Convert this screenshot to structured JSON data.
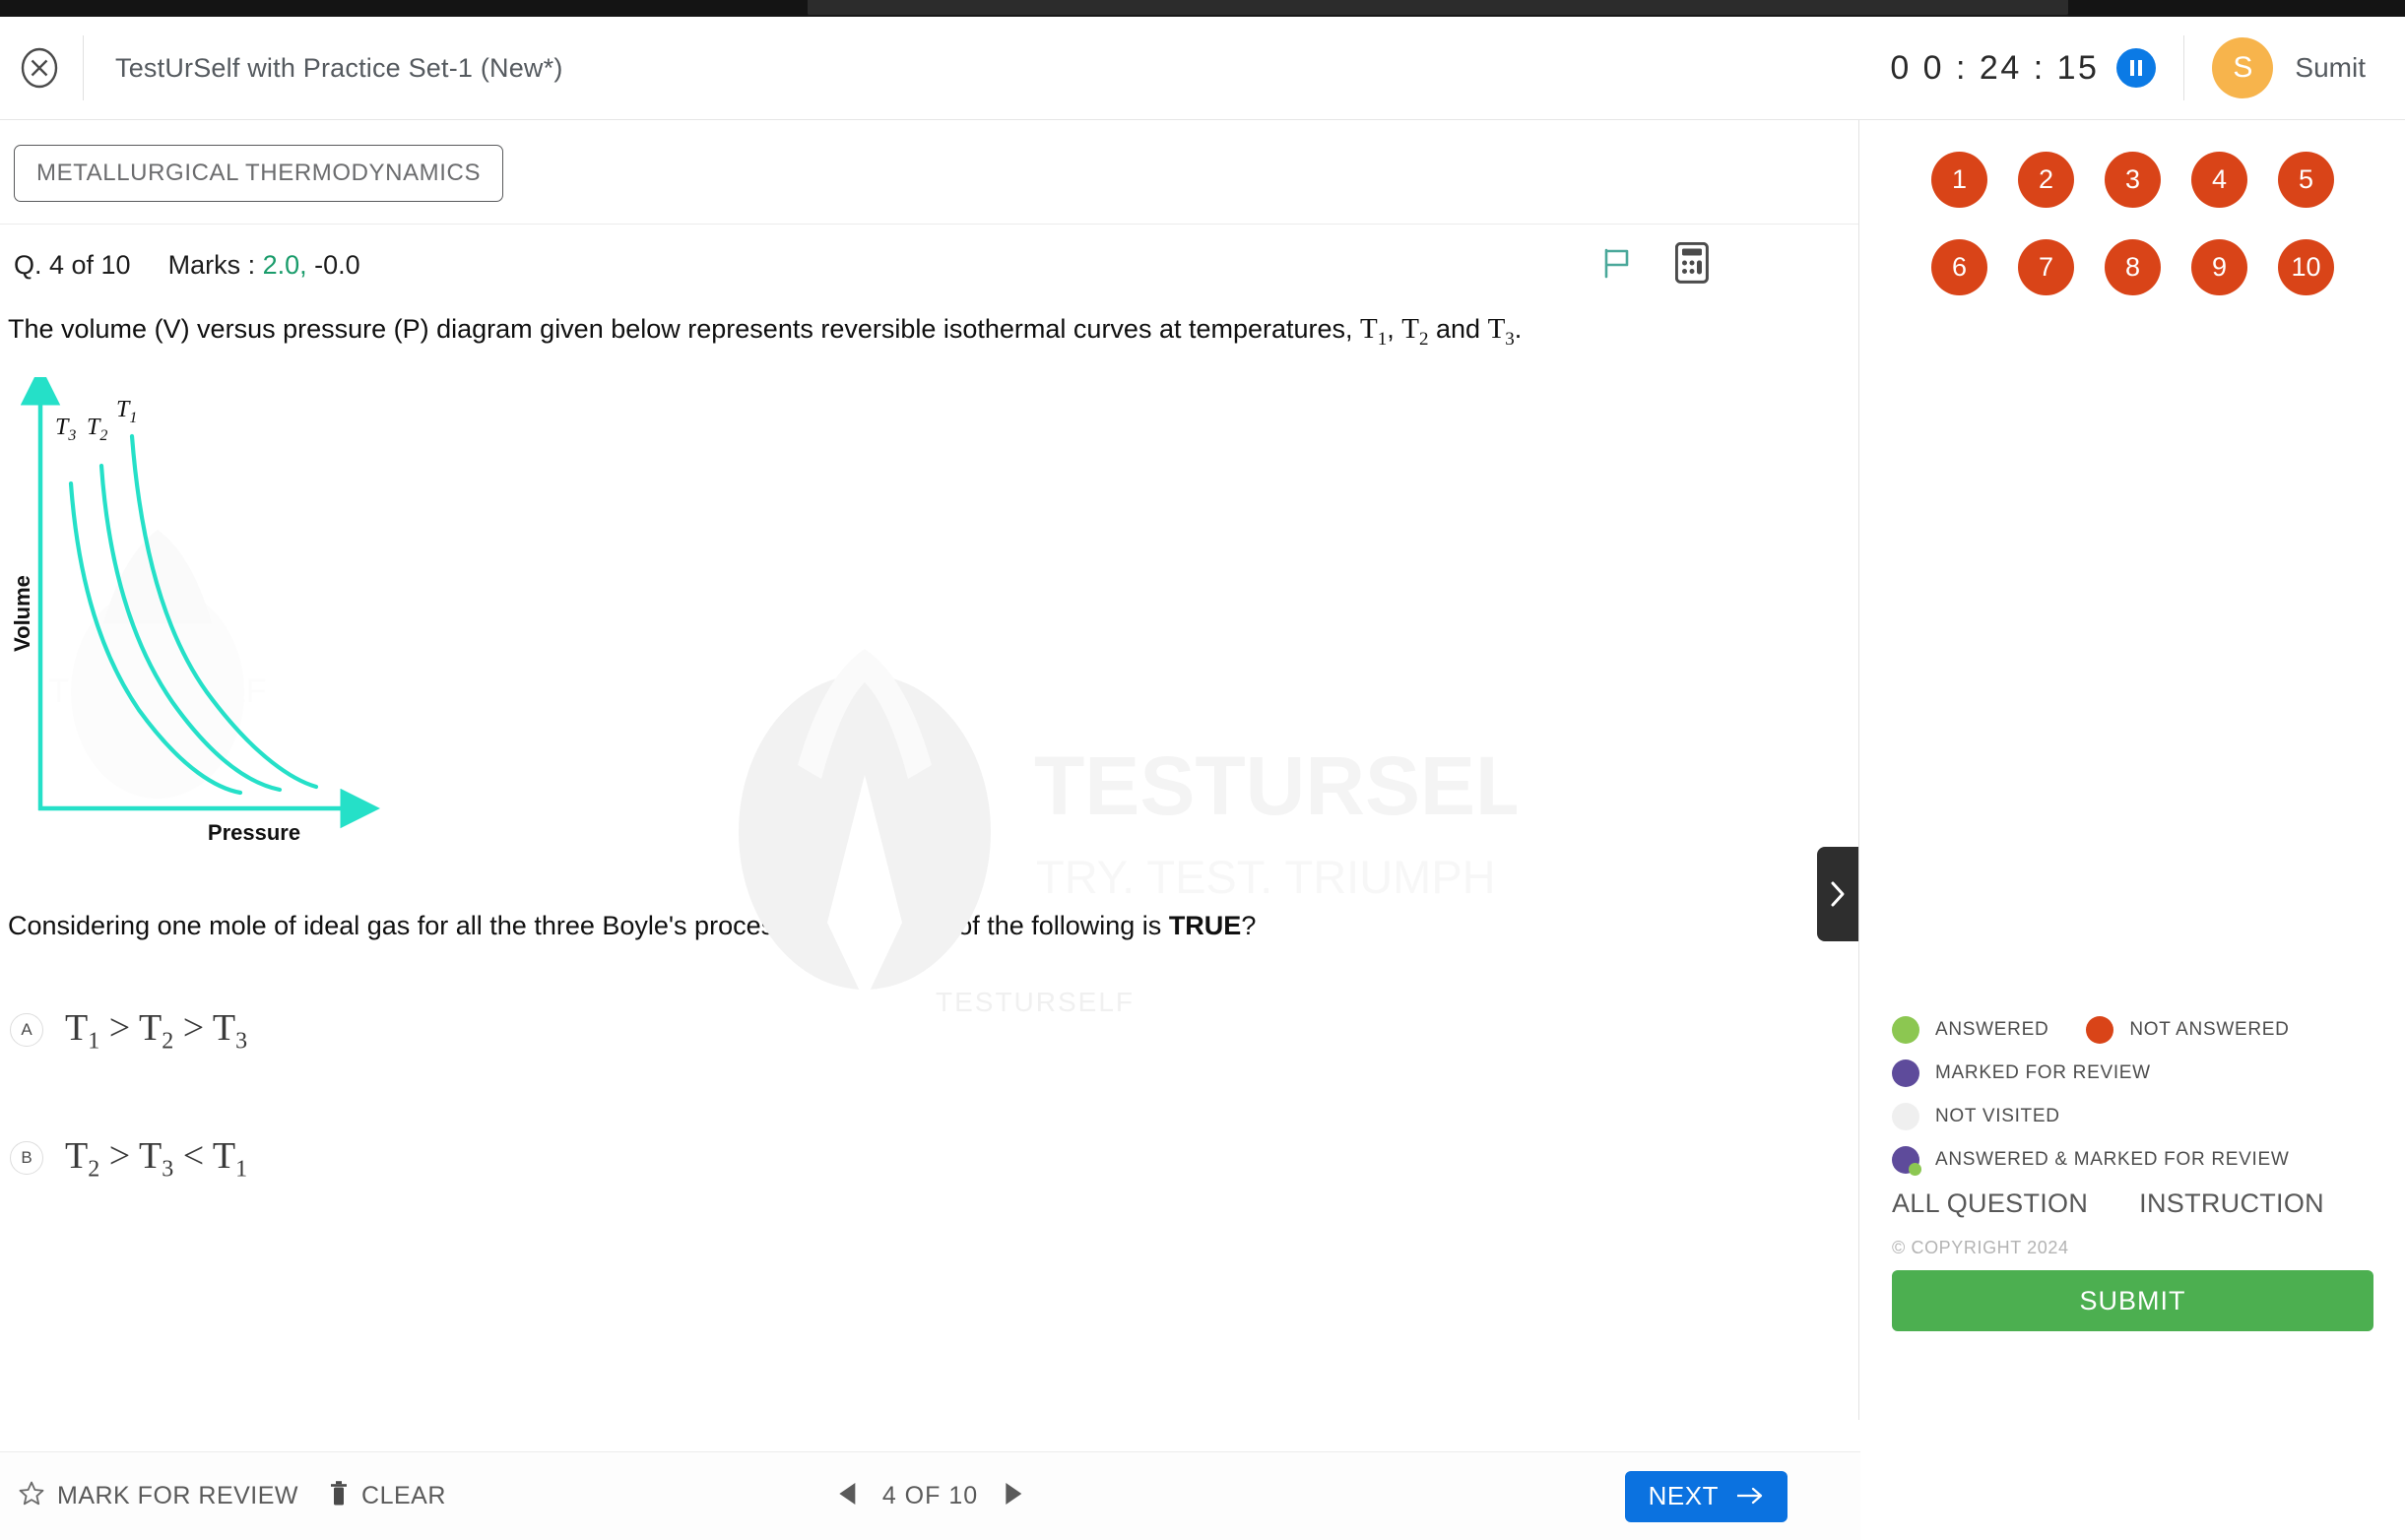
{
  "header": {
    "close_icon": "close-circle-icon",
    "exam_title": "TestUrSelf with Practice Set-1 (New*)",
    "timer": "0 0 : 24 : 15",
    "pause_icon": "pause-icon",
    "avatar_initial": "S",
    "user_name": "Sumit"
  },
  "question_panel": {
    "subject": "METALLURGICAL THERMODYNAMICS",
    "question_counter": "Q. 4 of 10",
    "marks_label": "Marks : ",
    "marks_positive": "2.0,",
    "marks_negative": "-0.0",
    "flag_icon": "flag-icon",
    "calculator_icon": "calculator-icon",
    "collapse_icon": "chevron-right-icon",
    "stem_part1": "The volume (V) versus pressure (P) diagram given below represents reversible isothermal curves at temperatures, ",
    "stem_var1": "T",
    "stem_sub1": "1",
    "stem_sep1": ", ",
    "stem_var2": "T",
    "stem_sub2": "2",
    "stem_sep2": " and ",
    "stem_var3": "T",
    "stem_sub3": "3",
    "stem_end": ".",
    "prompt_part1": "Considering one mole of ideal gas for all the three Boyle's processes, which one of the following is ",
    "prompt_bold": "TRUE",
    "prompt_end": "?",
    "options": [
      {
        "badge": "A",
        "text": "T₁ > T₂ > T₃"
      },
      {
        "badge": "B",
        "text": "T₂ > T₃ < T₁"
      }
    ]
  },
  "chart_data": {
    "type": "line",
    "title": "",
    "xlabel": "Pressure",
    "ylabel": "Volume",
    "grid": false,
    "legend": "inline-curve-labels",
    "axis_color": "#25e0c8",
    "curve_color": "#25e0c8",
    "series": [
      {
        "name": "T3",
        "label": "T",
        "sub": "3",
        "label_x": 78,
        "label_y": 322,
        "note": "lowest isotherm, closest to origin"
      },
      {
        "name": "T2",
        "label": "T",
        "sub": "2",
        "label_x": 109,
        "label_y": 322,
        "note": "middle isotherm"
      },
      {
        "name": "T1",
        "label": "T",
        "sub": "1",
        "label_x": 140,
        "label_y": 305,
        "note": "highest isotherm, farthest from origin"
      }
    ],
    "relationship": "PV = constant (hyperbolas); higher T lies farther from origin",
    "x_axis_range": "0 to max (arrow)",
    "y_axis_range": "0 to max (arrow)"
  },
  "palette": {
    "rows": [
      [
        "1",
        "2",
        "3",
        "4",
        "5"
      ],
      [
        "6",
        "7",
        "8",
        "9",
        "10"
      ]
    ],
    "status_color": "#d94418"
  },
  "legend": [
    {
      "label": "ANSWERED",
      "color": "#8cc751"
    },
    {
      "label": "NOT ANSWERED",
      "color": "#d94418"
    },
    {
      "label": "MARKED FOR REVIEW",
      "color": "#5e4b9b"
    },
    {
      "label": "NOT VISITED",
      "color": "#efefef"
    },
    {
      "label": "ANSWERED & MARKED FOR REVIEW",
      "color": "#5e4b9b"
    }
  ],
  "right_links": {
    "all_question": "ALL QUESTION",
    "instruction": "INSTRUCTION",
    "copyright": "© COPYRIGHT 2024",
    "submit": "SUBMIT"
  },
  "bottom_bar": {
    "mark_review_icon": "star-icon",
    "mark_review": "MARK FOR REVIEW",
    "clear_icon": "trash-icon",
    "clear": "CLEAR",
    "prev_icon": "triangle-left-icon",
    "pager": "4 OF 10",
    "next_icon": "triangle-right-icon",
    "next": "NEXT",
    "next_arrow_icon": "arrow-right-icon"
  },
  "watermark": {
    "brand": "TESTURSELF",
    "tagline": "TRY. TEST. TRIUMPH",
    "small": "TESTURSELF"
  }
}
